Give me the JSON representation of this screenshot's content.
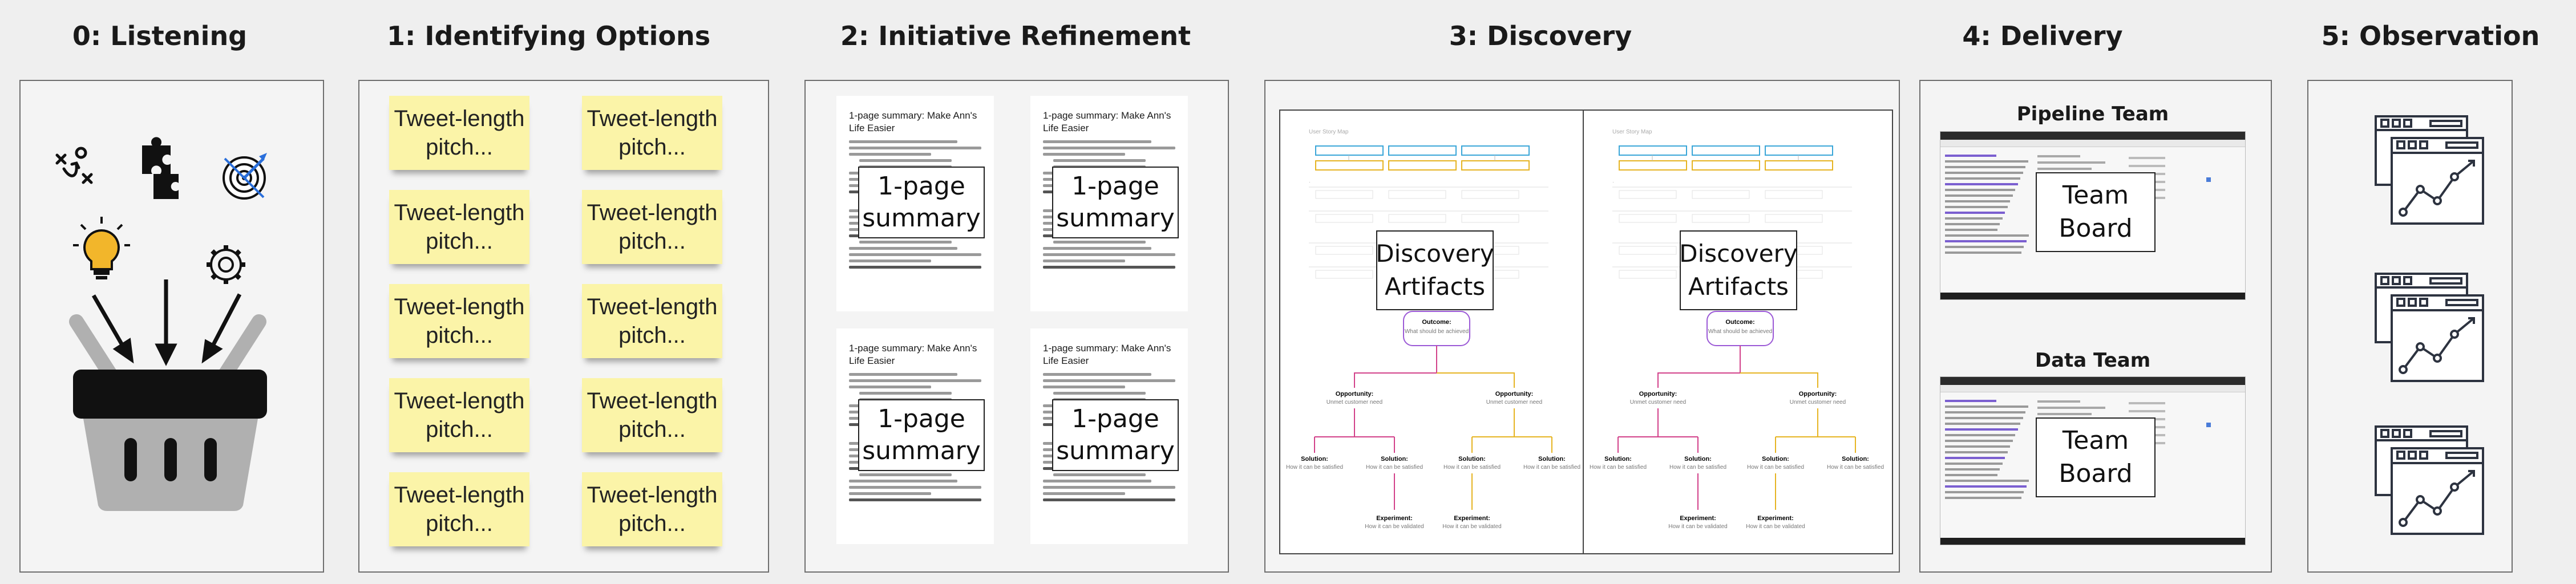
{
  "stages": [
    {
      "title": "0: Listening"
    },
    {
      "title": "1: Identifying Options"
    },
    {
      "title": "2: Initiative Refinement"
    },
    {
      "title": "3: Discovery"
    },
    {
      "title": "4: Delivery"
    },
    {
      "title": "5: Observation"
    }
  ],
  "listening": {
    "icons": [
      "strategy-play-icon",
      "puzzle-pieces-icon",
      "target-bullseye-icon",
      "lightbulb-icon",
      "gear-idea-icon",
      "shopping-basket-icon"
    ]
  },
  "options": {
    "stickies": [
      {
        "line1": "Tweet-length",
        "line2": "pitch..."
      },
      {
        "line1": "Tweet-length",
        "line2": "pitch..."
      },
      {
        "line1": "Tweet-length",
        "line2": "pitch..."
      },
      {
        "line1": "Tweet-length",
        "line2": "pitch..."
      },
      {
        "line1": "Tweet-length",
        "line2": "pitch..."
      },
      {
        "line1": "Tweet-length",
        "line2": "pitch..."
      },
      {
        "line1": "Tweet-length",
        "line2": "pitch..."
      },
      {
        "line1": "Tweet-length",
        "line2": "pitch..."
      },
      {
        "line1": "Tweet-length",
        "line2": "pitch..."
      },
      {
        "line1": "Tweet-length",
        "line2": "pitch..."
      }
    ]
  },
  "refinement": {
    "doc_title": "1-page summary: Make Ann's Life Easier",
    "summary_line1": "1-page",
    "summary_line2": "summary"
  },
  "discovery": {
    "artifact_line1": "Discovery",
    "artifact_line2": "Artifacts",
    "outcome_title": "Outcome:",
    "outcome_text": "What should be achieved",
    "opportunity_title": "Opportunity:",
    "opportunity_text": "Unmet customer need",
    "solution_title": "Solution:",
    "solution_text": "How it can be satisfied",
    "experiment_title": "Experiment:",
    "experiment_text": "How it can be validated",
    "header_label": "User Story Map"
  },
  "delivery": {
    "teams": [
      {
        "name": "Pipeline Team",
        "board_line1": "Team",
        "board_line2": "Board"
      },
      {
        "name": "Data Team",
        "board_line1": "Team",
        "board_line2": "Board"
      }
    ]
  },
  "observation": {
    "icons": [
      "dashboard-chart-icon",
      "dashboard-chart-icon",
      "dashboard-chart-icon"
    ]
  },
  "colors": {
    "sticky": "#fbf4a8",
    "basket": "#b0b0b0",
    "basket_top": "#111111",
    "bulb": "#f2b62b",
    "target": "#2a6fdb",
    "tree_pink": "#d2418a",
    "tree_yellow": "#e6b422",
    "tree_purple": "#9b59d6",
    "map_blue": "#3aa6d8"
  }
}
